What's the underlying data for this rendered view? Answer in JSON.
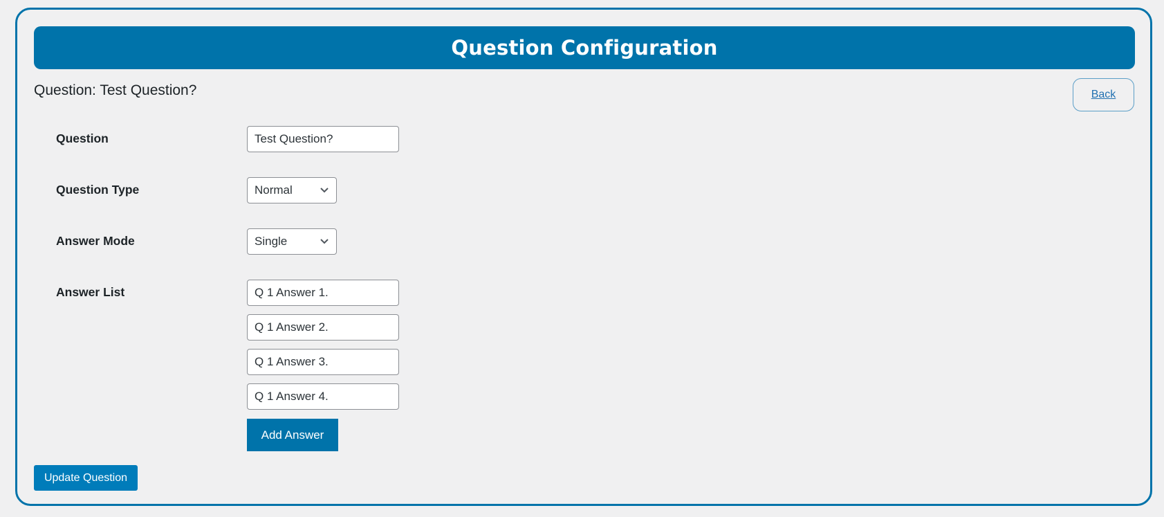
{
  "header": {
    "title": "Question Configuration"
  },
  "subtitle": "Question: Test Question?",
  "back_button": {
    "label": "Back"
  },
  "form": {
    "question": {
      "label": "Question",
      "value": "Test Question?"
    },
    "question_type": {
      "label": "Question Type",
      "selected": "Normal",
      "icon": "chevron-down-icon"
    },
    "answer_mode": {
      "label": "Answer Mode",
      "selected": "Single",
      "icon": "chevron-down-icon"
    },
    "answer_list": {
      "label": "Answer List",
      "answers": [
        "Q 1 Answer 1.",
        "Q 1 Answer 2.",
        "Q 1 Answer 3.",
        "Q 1 Answer 4."
      ],
      "add_button_label": "Add Answer"
    }
  },
  "update_button": {
    "label": "Update Question"
  },
  "colors": {
    "primary": "#0073aa",
    "button_secondary": "#007cba",
    "background": "#f0f0f1",
    "link": "#2271b1"
  }
}
